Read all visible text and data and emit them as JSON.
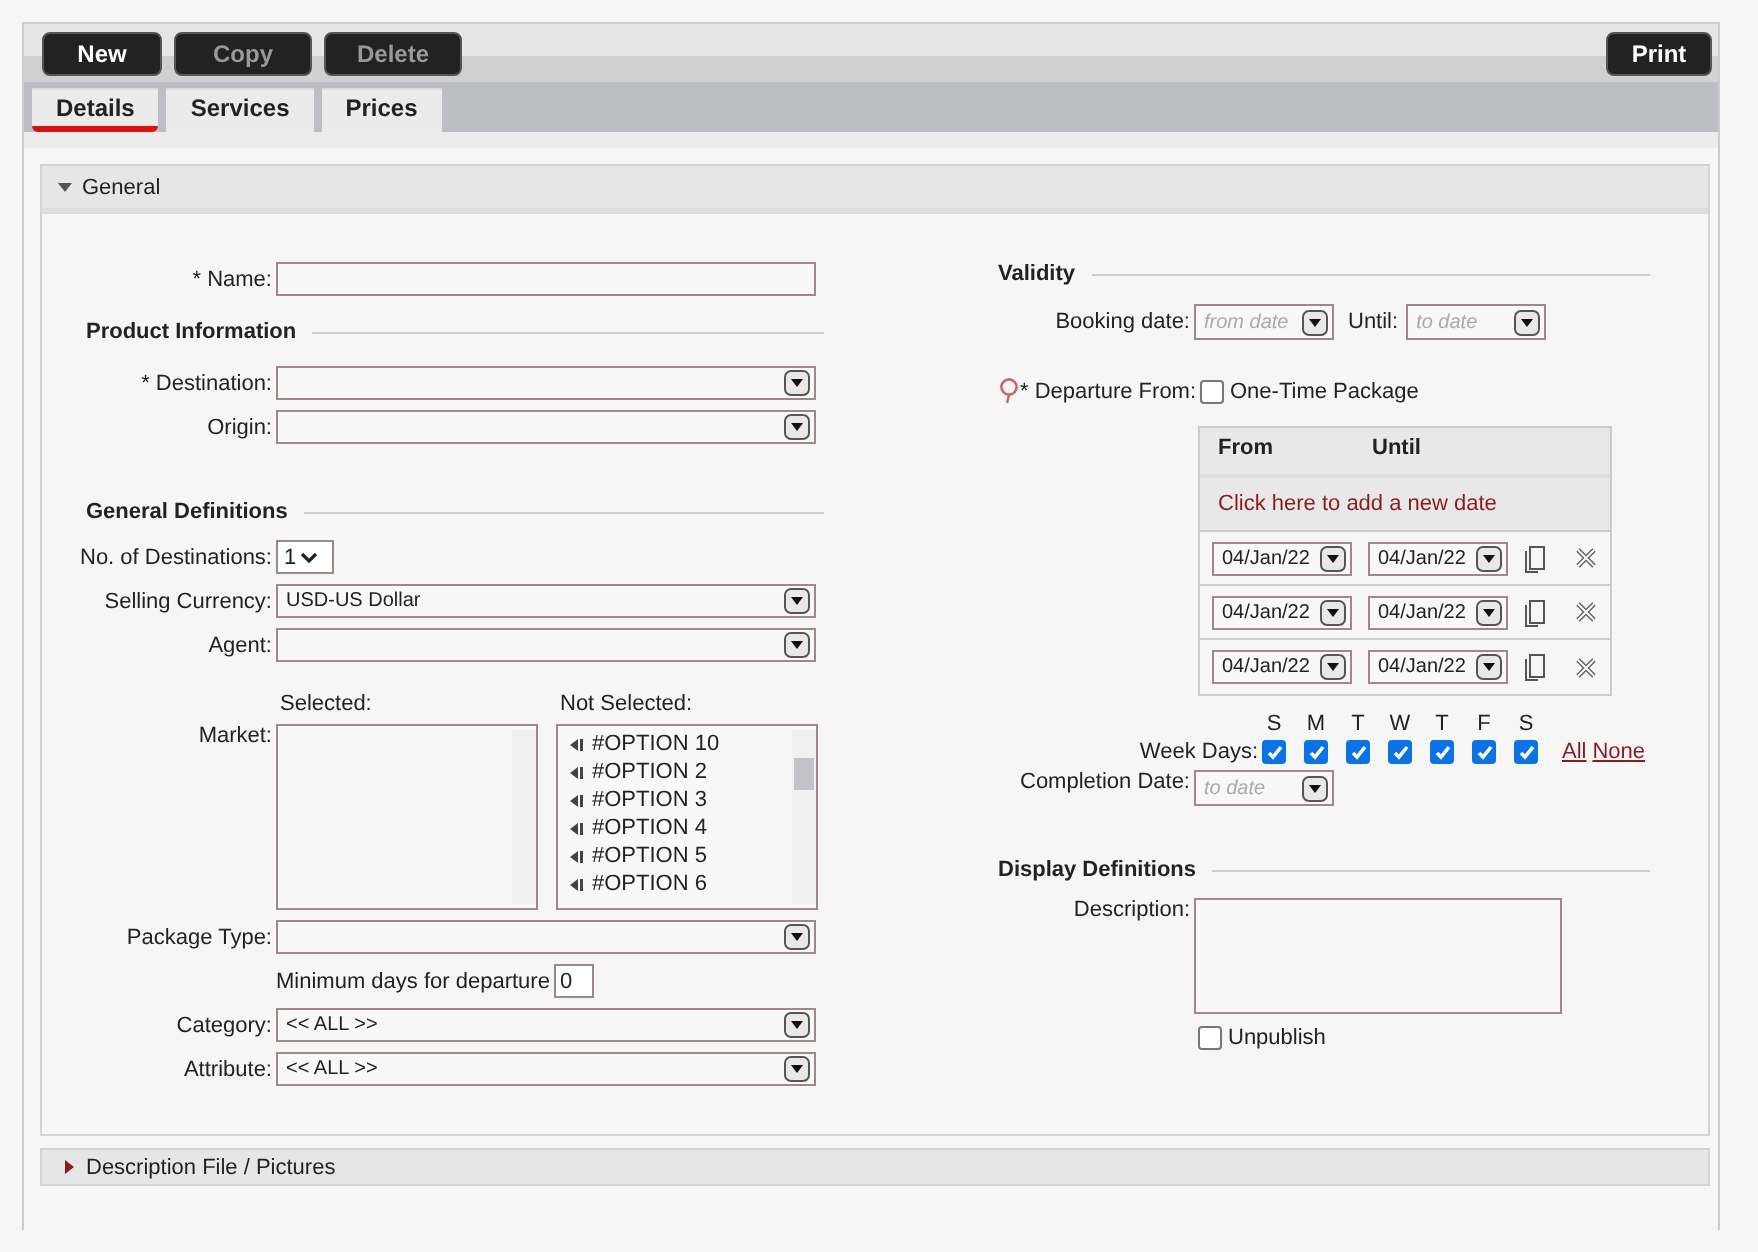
{
  "toolbar": {
    "buttons": [
      {
        "label": "New",
        "disabled": false
      },
      {
        "label": "Copy",
        "disabled": true
      },
      {
        "label": "Delete",
        "disabled": true
      }
    ],
    "print": "Print"
  },
  "tabs": [
    {
      "label": "Details",
      "selected": true
    },
    {
      "label": "Services",
      "selected": false
    },
    {
      "label": "Prices",
      "selected": false
    }
  ],
  "sections": [
    {
      "title": "General",
      "expanded": true
    },
    {
      "title": "Description File / Pictures",
      "expanded": false
    }
  ],
  "left": {
    "name_label": "* Name:",
    "groups": [
      {
        "title": "Product Information",
        "fields": [
          {
            "kind": "select",
            "label": "* Destination:"
          },
          {
            "kind": "select",
            "label": "Origin:"
          }
        ]
      },
      {
        "title": "General Definitions",
        "fields": [
          {
            "kind": "small_select",
            "label": "No. of Destinations:",
            "value": "1"
          },
          {
            "kind": "select",
            "label": "Selling Currency:",
            "value": "USD-US Dollar"
          },
          {
            "kind": "select",
            "label": "Agent:"
          },
          {
            "kind": "market",
            "label": "Market:",
            "selected_label": "Selected:",
            "not_selected_label": "Not Selected:",
            "options": [
              "#OPTION 10",
              "#OPTION 2",
              "#OPTION 3",
              "#OPTION 4",
              "#OPTION 5",
              "#OPTION 6"
            ]
          },
          {
            "kind": "select",
            "label": "Package Type:"
          },
          {
            "kind": "number",
            "label": "Minimum days for departure",
            "value": "0"
          },
          {
            "kind": "select",
            "label": "Category:",
            "value": "<< ALL >>"
          },
          {
            "kind": "select",
            "label": "Attribute:",
            "value": "<< ALL >>"
          }
        ]
      }
    ]
  },
  "right": {
    "validity": {
      "title": "Validity",
      "booking_label": "Booking date:",
      "from_placeholder": "from date",
      "until_label": "Until:",
      "until_placeholder": "to date"
    },
    "departure": {
      "label": "* Departure From:",
      "one_time_label": "One-Time Package",
      "one_time_checked": false,
      "columns": [
        "From",
        "Until"
      ],
      "add_link": "Click here to add a new date",
      "rows": [
        {
          "from": "04/Jan/22",
          "until": "04/Jan/22"
        },
        {
          "from": "04/Jan/22",
          "until": "04/Jan/22"
        },
        {
          "from": "04/Jan/22",
          "until": "04/Jan/22"
        }
      ]
    },
    "week_days": {
      "label": "Week Days:",
      "all": "All",
      "none": "None",
      "days": [
        {
          "letter": "S",
          "checked": true
        },
        {
          "letter": "M",
          "checked": true
        },
        {
          "letter": "T",
          "checked": true
        },
        {
          "letter": "W",
          "checked": true
        },
        {
          "letter": "T",
          "checked": true
        },
        {
          "letter": "F",
          "checked": true
        },
        {
          "letter": "S",
          "checked": true
        }
      ]
    },
    "completion": {
      "label": "Completion Date:",
      "placeholder": "to date"
    },
    "display": {
      "title": "Display Definitions",
      "description_label": "Description:",
      "unpublish_label": "Unpublish",
      "unpublish_checked": false
    }
  }
}
